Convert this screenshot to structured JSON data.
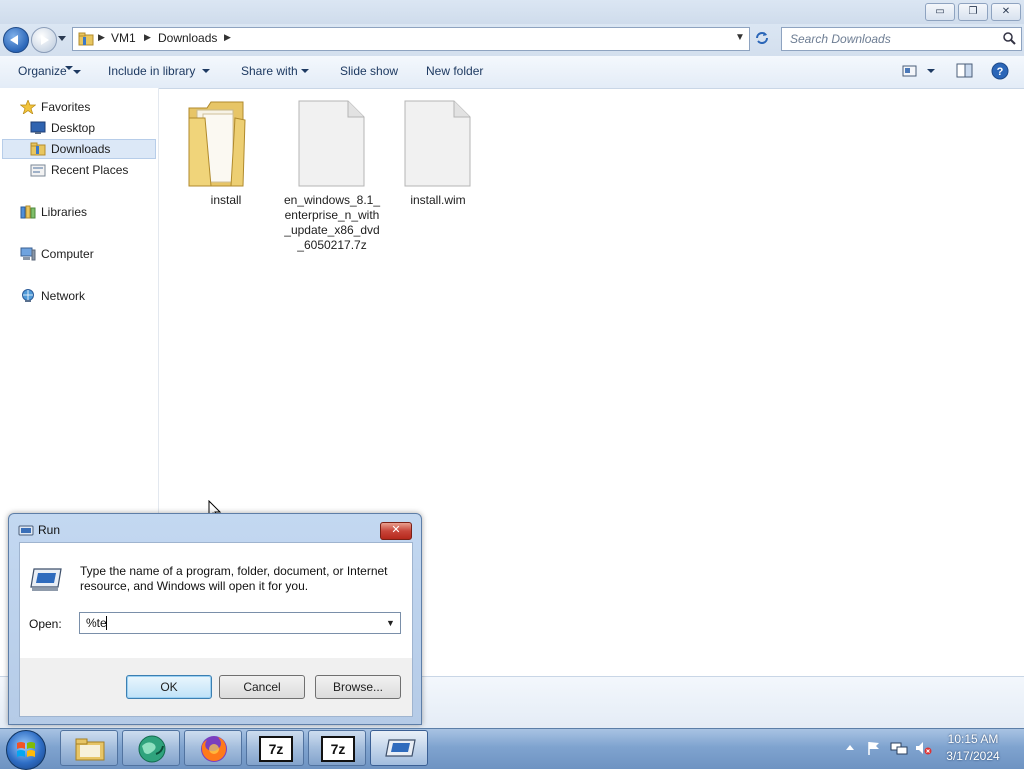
{
  "window": {
    "minimize_symbol": "▭",
    "restore_symbol": "❐",
    "close_symbol": "✕"
  },
  "address": {
    "breadcrumbs": [
      "VM1",
      "Downloads"
    ],
    "search_placeholder": "Search Downloads"
  },
  "toolbar": {
    "organize": "Organize",
    "include_in_library": "Include in library",
    "share_with": "Share with",
    "slide_show": "Slide show",
    "new_folder": "New folder"
  },
  "sidebar": {
    "favorites": "Favorites",
    "desktop": "Desktop",
    "downloads": "Downloads",
    "recent_places": "Recent Places",
    "libraries": "Libraries",
    "computer": "Computer",
    "network": "Network"
  },
  "files": [
    {
      "name": "install",
      "type": "folder"
    },
    {
      "name": "en_windows_8.1_\nenterprise_n_with\n_update_x86_dvd\n_6050217.7z",
      "type": "file"
    },
    {
      "name": "install.wim",
      "type": "file"
    }
  ],
  "run_dialog": {
    "title": "Run",
    "description": "Type the name of a program, folder, document, or Internet resource, and Windows will open it for you.",
    "open_label": "Open:",
    "open_value": "%te",
    "ok": "OK",
    "cancel": "Cancel",
    "browse": "Browse...",
    "close_symbol": "✕"
  },
  "taskbar": {
    "apps": [
      "windows-explorer",
      "browser-globe",
      "firefox",
      "7-zip",
      "7-zip",
      "run"
    ],
    "active_app": "run",
    "sevenzip_label": "7z"
  },
  "clock": {
    "time": "10:15 AM",
    "date": "3/17/2024"
  },
  "colors": {
    "accent": "#2b66b8",
    "close_red": "#c8453a",
    "selection": "#dce8f7"
  }
}
